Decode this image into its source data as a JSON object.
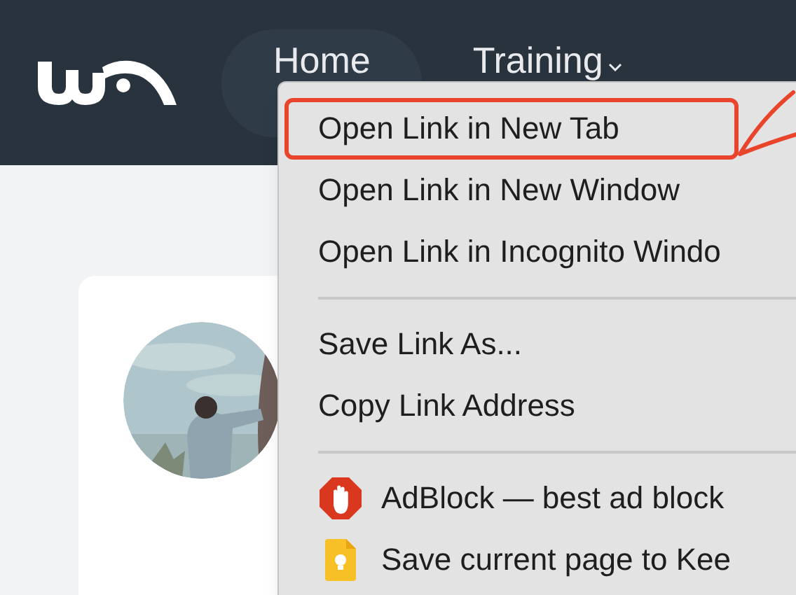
{
  "header": {
    "nav": [
      {
        "label": "Home",
        "selected": true,
        "dropdown": false
      },
      {
        "label": "Training",
        "selected": false,
        "dropdown": true
      }
    ]
  },
  "context_menu": {
    "groups": [
      [
        {
          "label": "Open Link in New Tab",
          "kind": "plain",
          "annotated": true
        },
        {
          "label": "Open Link in New Window",
          "kind": "plain",
          "annotated": false
        },
        {
          "label": "Open Link in Incognito Windo",
          "kind": "plain",
          "annotated": false
        }
      ],
      [
        {
          "label": "Save Link As...",
          "kind": "plain",
          "annotated": false
        },
        {
          "label": "Copy Link Address",
          "kind": "plain",
          "annotated": false
        }
      ],
      [
        {
          "label": "AdBlock — best ad block",
          "kind": "adblock",
          "annotated": false
        },
        {
          "label": "Save current page to Kee",
          "kind": "keep",
          "annotated": false
        }
      ]
    ]
  }
}
